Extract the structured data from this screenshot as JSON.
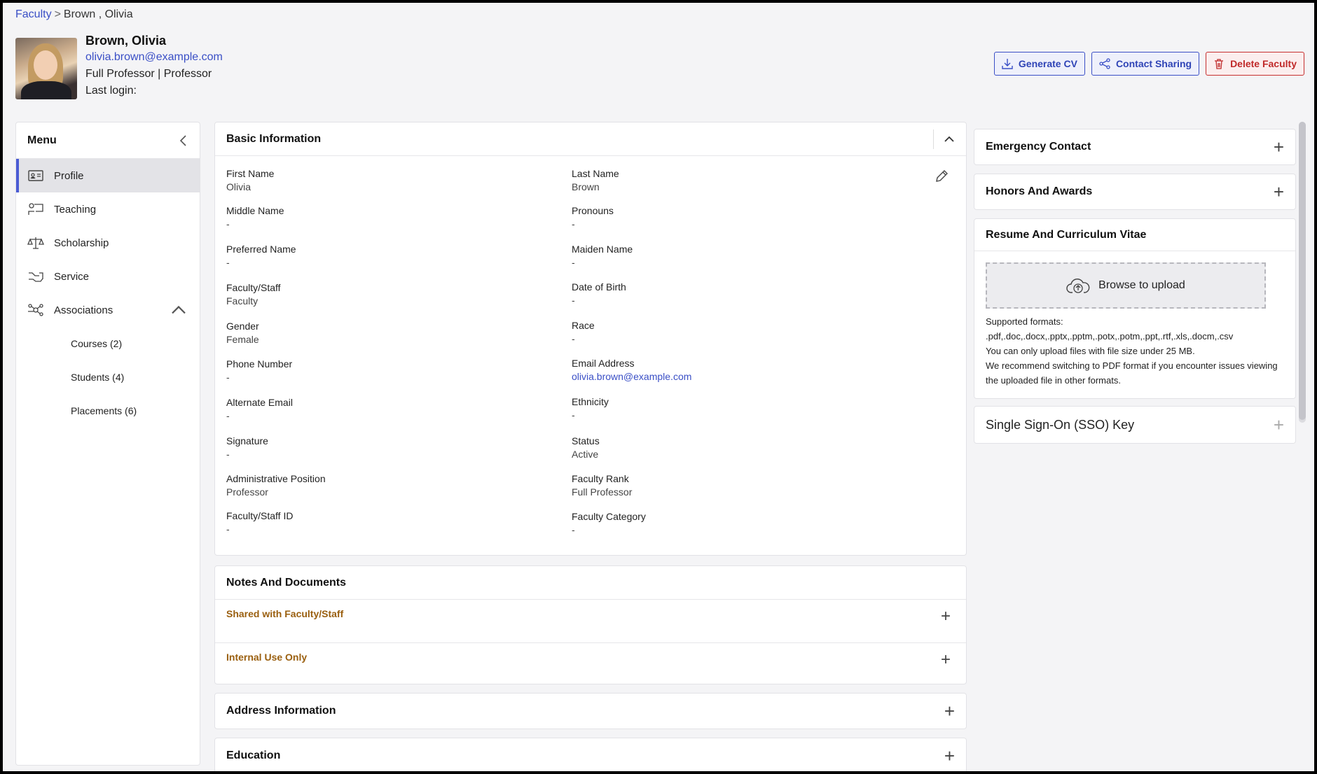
{
  "breadcrumb": {
    "root": "Faculty",
    "separator": ">",
    "current": "Brown , Olivia"
  },
  "header": {
    "name": "Brown, Olivia",
    "email": "olivia.brown@example.com",
    "rank_line": "Full Professor | Professor",
    "last_login": "Last login:",
    "actions": {
      "generate_cv": "Generate CV",
      "contact_sharing": "Contact Sharing",
      "delete_faculty": "Delete Faculty"
    }
  },
  "menu": {
    "title": "Menu",
    "items": [
      {
        "label": "Profile",
        "icon": "id-card-icon"
      },
      {
        "label": "Teaching",
        "icon": "teaching-icon"
      },
      {
        "label": "Scholarship",
        "icon": "scholarship-icon"
      },
      {
        "label": "Service",
        "icon": "service-icon"
      },
      {
        "label": "Associations",
        "icon": "associations-icon"
      }
    ],
    "sub_items": [
      "Courses (2)",
      "Students (4)",
      "Placements (6)"
    ]
  },
  "basic": {
    "title": "Basic Information",
    "left": [
      {
        "label": "First Name",
        "value": "Olivia"
      },
      {
        "label": "Middle Name",
        "value": "-"
      },
      {
        "label": "Preferred Name",
        "value": "-"
      },
      {
        "label": "Faculty/Staff",
        "value": "Faculty"
      },
      {
        "label": "Gender",
        "value": "Female"
      },
      {
        "label": "Phone Number",
        "value": "-"
      },
      {
        "label": "Alternate Email",
        "value": "-"
      },
      {
        "label": "Signature",
        "value": "-"
      },
      {
        "label": "Administrative Position",
        "value": "Professor"
      },
      {
        "label": "Faculty/Staff ID",
        "value": "-"
      }
    ],
    "right": [
      {
        "label": "Last Name",
        "value": "Brown"
      },
      {
        "label": "Pronouns",
        "value": "-"
      },
      {
        "label": "Maiden Name",
        "value": "-"
      },
      {
        "label": "Date of Birth",
        "value": "-"
      },
      {
        "label": "Race",
        "value": "-"
      },
      {
        "label": "Email Address",
        "value": "olivia.brown@example.com"
      },
      {
        "label": "Ethnicity",
        "value": "-"
      },
      {
        "label": "Status",
        "value": "Active"
      },
      {
        "label": "Faculty Rank",
        "value": "Full Professor"
      },
      {
        "label": "Faculty Category",
        "value": "-"
      }
    ]
  },
  "notes": {
    "title": "Notes And Documents",
    "shared": "Shared with Faculty/Staff",
    "internal": "Internal Use Only"
  },
  "address": {
    "title": "Address Information"
  },
  "education": {
    "title": "Education"
  },
  "right": {
    "emergency": "Emergency Contact",
    "honors": "Honors And Awards",
    "resume": {
      "title": "Resume And Curriculum Vitae",
      "upload": "Browse to upload",
      "formats_label": "Supported formats:",
      "formats": ".pdf,.doc,.docx,.pptx,.pptm,.potx,.potm,.ppt,.rtf,.xls,.docm,.csv",
      "size_note": "You can only upload files with file size under 25 MB.",
      "recommend": "We recommend switching to PDF format if you encounter issues viewing the uploaded file in other formats."
    },
    "sso": "Single Sign-On (SSO) Key"
  },
  "colors": {
    "accent": "#3a4fc6",
    "danger": "#c62f2f",
    "note_label": "#9a5f0f"
  }
}
